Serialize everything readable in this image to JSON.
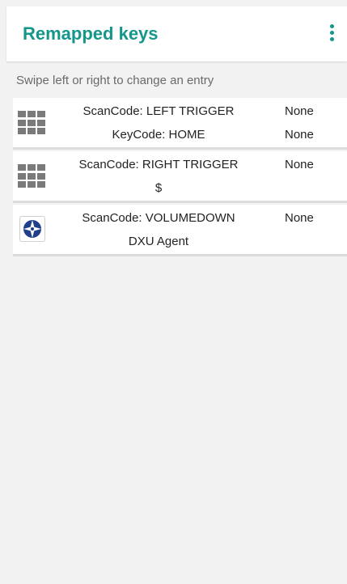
{
  "app_bar": {
    "title": "Remapped keys",
    "menu_icon": "more-vert-icon",
    "accent_color": "#14968a"
  },
  "hint": "Swipe left or right to change an entry",
  "entries": [
    {
      "icon": "grid-icon",
      "scan_line": "ScanCode: LEFT TRIGGER",
      "second_line": "KeyCode: HOME",
      "value_1": "None",
      "value_2": "None"
    },
    {
      "icon": "grid-icon",
      "scan_line": "ScanCode: RIGHT TRIGGER",
      "second_line": "$",
      "value_1": "None",
      "value_2": ""
    },
    {
      "icon": "dxu-agent-icon",
      "scan_line": "ScanCode: VOLUMEDOWN",
      "second_line": "DXU Agent",
      "value_1": "None",
      "value_2": ""
    }
  ]
}
